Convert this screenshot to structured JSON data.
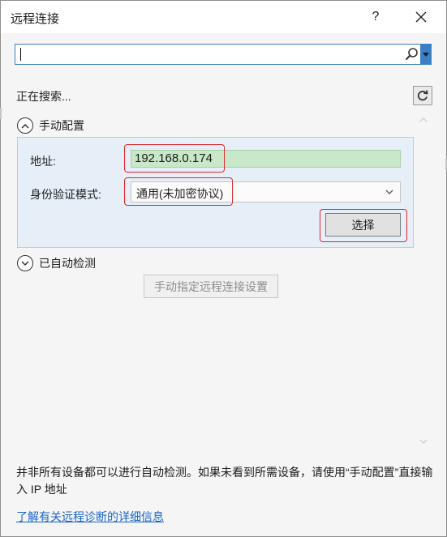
{
  "dialog": {
    "title": "远程连接",
    "help_label": "?",
    "close_icon": "close-icon"
  },
  "search": {
    "value": "",
    "placeholder": "",
    "icon": "search-icon",
    "dropdown_icon": "caret-down-icon"
  },
  "status": {
    "searching_text": "正在搜索...",
    "refresh_icon": "refresh-icon"
  },
  "manual_config": {
    "header_label": "手动配置",
    "expanded": true,
    "address_label": "地址:",
    "address_value": "192.168.0.174",
    "auth_label": "身份验证模式:",
    "auth_value": "通用(未加密协议)",
    "select_button": "选择"
  },
  "auto_detected": {
    "header_label": "已自动检测",
    "expanded": false,
    "manual_settings_button": "手动指定远程连接设置"
  },
  "footer": {
    "note": "并非所有设备都可以进行自动检测。如果未看到所需设备，请使用“手动配置”直接输入 IP 地址",
    "learn_more_link": "了解有关远程诊断的详细信息"
  },
  "colors": {
    "accent": "#3c7fc5",
    "address_bg": "#c9e8c9",
    "highlight": "#e0262c",
    "link": "#1a64c6",
    "panel_bg": "#e6eef7"
  }
}
